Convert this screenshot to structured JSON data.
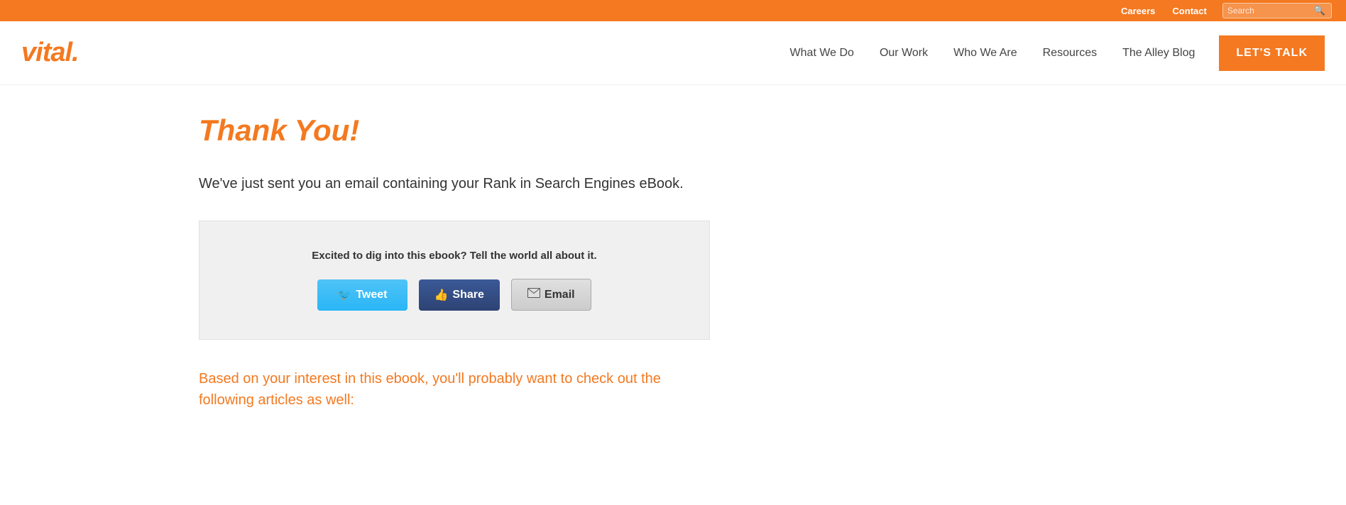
{
  "topbar": {
    "careers_label": "Careers",
    "contact_label": "Contact",
    "search_placeholder": "Search",
    "search_icon": "🔍"
  },
  "nav": {
    "logo_text": "vital.",
    "links": [
      {
        "label": "What We Do",
        "id": "what-we-do"
      },
      {
        "label": "Our Work",
        "id": "our-work"
      },
      {
        "label": "Who We Are",
        "id": "who-we-are"
      },
      {
        "label": "Resources",
        "id": "resources"
      },
      {
        "label": "The Alley Blog",
        "id": "the-alley-blog"
      }
    ],
    "cta_label": "LET'S TALK"
  },
  "main": {
    "heading": "Thank You!",
    "sent_message": "We've just sent you an email containing your Rank in Search Engines eBook.",
    "share_box": {
      "prompt_text": "Excited to dig into this ebook? Tell the world all about it.",
      "tweet_label": "Tweet",
      "share_label": "Share",
      "email_label": "Email"
    },
    "related_text": "Based on your interest in this ebook, you'll probably want to check out the following articles as well:"
  }
}
